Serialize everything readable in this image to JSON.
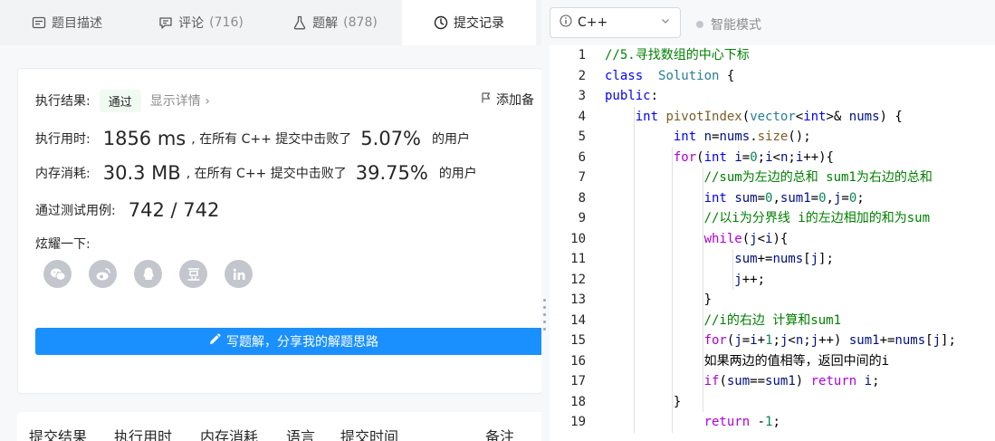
{
  "tabs": [
    {
      "label": "题目描述",
      "count": "",
      "icon": "description-icon"
    },
    {
      "label": "评论",
      "count": "(716)",
      "icon": "comment-icon"
    },
    {
      "label": "题解",
      "count": "(878)",
      "icon": "flask-icon"
    },
    {
      "label": "提交记录",
      "count": "",
      "icon": "clock-icon"
    }
  ],
  "result": {
    "label": "执行结果:",
    "status": "通过",
    "detail": "显示详情",
    "note": "添加备",
    "time_label": "执行用时:",
    "time_value": "1856 ms",
    "time_mid": ", 在所有 C++ 提交中击败了",
    "time_pct": "5.07%",
    "time_suffix": "的用户",
    "mem_label": "内存消耗:",
    "mem_value": "30.3 MB",
    "mem_mid": ", 在所有 C++ 提交中击败了",
    "mem_pct": "39.75%",
    "mem_suffix": "的用户",
    "tests_label": "通过测试用例:",
    "tests_value": "742 / 742",
    "share_label": "炫耀一下:",
    "share_icons": [
      "wechat-icon",
      "weibo-icon",
      "qq-icon",
      "douban-icon",
      "linkedin-icon"
    ],
    "write_button": "写题解，分享我的解题思路"
  },
  "table_headers": [
    "提交结果",
    "执行用时",
    "内存消耗",
    "语言",
    "提交时间",
    "备注"
  ],
  "editor": {
    "language": "C++",
    "smart_mode": "智能模式",
    "line_numbers": [
      "1",
      "2",
      "3",
      "4",
      "5",
      "6",
      "7",
      "8",
      "9",
      "10",
      "11",
      "12",
      "13",
      "14",
      "15",
      "16",
      "17",
      "18",
      "19"
    ],
    "lines": [
      [
        [
          "cm",
          "//5.寻找数组的中心下标"
        ]
      ],
      [
        [
          "kw",
          "class"
        ],
        [
          "",
          "  "
        ],
        [
          "ty",
          "Solution"
        ],
        [
          "",
          " {"
        ]
      ],
      [
        [
          "kw",
          "public"
        ],
        [
          "",
          ":"
        ]
      ],
      [
        [
          "",
          "    "
        ],
        [
          "kw",
          "int"
        ],
        [
          "",
          " "
        ],
        [
          "fn",
          "pivotIndex"
        ],
        [
          "",
          "("
        ],
        [
          "ty",
          "vector"
        ],
        [
          "",
          "<"
        ],
        [
          "kw",
          "int"
        ],
        [
          "",
          ">&"
        ],
        [
          "",
          " "
        ],
        [
          "id",
          "nums"
        ],
        [
          "",
          ") {"
        ]
      ],
      [
        [
          "",
          "         "
        ],
        [
          "kw",
          "int"
        ],
        [
          "",
          " "
        ],
        [
          "id",
          "n"
        ],
        [
          "",
          "="
        ],
        [
          "id",
          "nums"
        ],
        [
          "",
          "."
        ],
        [
          "fn",
          "size"
        ],
        [
          "",
          "();"
        ]
      ],
      [
        [
          "",
          "         "
        ],
        [
          "pp",
          "for"
        ],
        [
          "",
          "("
        ],
        [
          "kw",
          "int"
        ],
        [
          "",
          " "
        ],
        [
          "id",
          "i"
        ],
        [
          "",
          "="
        ],
        [
          "nm",
          "0"
        ],
        [
          "",
          ";"
        ],
        [
          "id",
          "i"
        ],
        [
          "",
          "<"
        ],
        [
          "id",
          "n"
        ],
        [
          "",
          ";"
        ],
        [
          "id",
          "i"
        ],
        [
          "",
          "++){"
        ]
      ],
      [
        [
          "",
          "             "
        ],
        [
          "cm",
          "//sum为左边的总和 sum1为右边的总和"
        ]
      ],
      [
        [
          "",
          "             "
        ],
        [
          "kw",
          "int"
        ],
        [
          "",
          " "
        ],
        [
          "id",
          "sum"
        ],
        [
          "",
          "="
        ],
        [
          "nm",
          "0"
        ],
        [
          "",
          ","
        ],
        [
          "id",
          "sum1"
        ],
        [
          "",
          "="
        ],
        [
          "nm",
          "0"
        ],
        [
          "",
          ","
        ],
        [
          "id",
          "j"
        ],
        [
          "",
          "="
        ],
        [
          "nm",
          "0"
        ],
        [
          "",
          ";"
        ]
      ],
      [
        [
          "",
          "             "
        ],
        [
          "cm",
          "//以i为分界线 i的左边相加的和为sum"
        ]
      ],
      [
        [
          "",
          "             "
        ],
        [
          "pp",
          "while"
        ],
        [
          "",
          "("
        ],
        [
          "id",
          "j"
        ],
        [
          "",
          "<"
        ],
        [
          "id",
          "i"
        ],
        [
          "",
          "){"
        ]
      ],
      [
        [
          "",
          "                 "
        ],
        [
          "id",
          "sum"
        ],
        [
          "",
          "+="
        ],
        [
          "id",
          "nums"
        ],
        [
          "",
          "["
        ],
        [
          "id",
          "j"
        ],
        [
          "",
          "];"
        ]
      ],
      [
        [
          "",
          "                 "
        ],
        [
          "id",
          "j"
        ],
        [
          "",
          "++;"
        ]
      ],
      [
        [
          "",
          "             "
        ],
        [
          "",
          "}"
        ]
      ],
      [
        [
          "",
          "             "
        ],
        [
          "cm",
          "//i的右边 计算和sum1"
        ]
      ],
      [
        [
          "",
          "             "
        ],
        [
          "pp",
          "for"
        ],
        [
          "",
          "("
        ],
        [
          "id",
          "j"
        ],
        [
          "",
          "="
        ],
        [
          "id",
          "i"
        ],
        [
          "",
          "+"
        ],
        [
          "nm",
          "1"
        ],
        [
          "",
          ";"
        ],
        [
          "id",
          "j"
        ],
        [
          "",
          "<"
        ],
        [
          "id",
          "n"
        ],
        [
          "",
          ";"
        ],
        [
          "id",
          "j"
        ],
        [
          "",
          "++) "
        ],
        [
          "id",
          "sum1"
        ],
        [
          "",
          "+="
        ],
        [
          "id",
          "nums"
        ],
        [
          "",
          "["
        ],
        [
          "id",
          "j"
        ],
        [
          "",
          "];"
        ]
      ],
      [
        [
          "",
          "             "
        ],
        [
          "",
          "如果两边的值相等，返回中间的i"
        ]
      ],
      [
        [
          "",
          "             "
        ],
        [
          "pp",
          "if"
        ],
        [
          "",
          "("
        ],
        [
          "id",
          "sum"
        ],
        [
          "",
          "=="
        ],
        [
          "id",
          "sum1"
        ],
        [
          "",
          ") "
        ],
        [
          "pp",
          "return"
        ],
        [
          "",
          " "
        ],
        [
          "id",
          "i"
        ],
        [
          "",
          ";"
        ]
      ],
      [
        [
          "",
          "         "
        ],
        [
          "",
          "}"
        ]
      ],
      [
        [
          "",
          "             "
        ],
        [
          "pp",
          "return"
        ],
        [
          "",
          " -"
        ],
        [
          "nm",
          "1"
        ],
        [
          "",
          ";"
        ]
      ]
    ]
  }
}
